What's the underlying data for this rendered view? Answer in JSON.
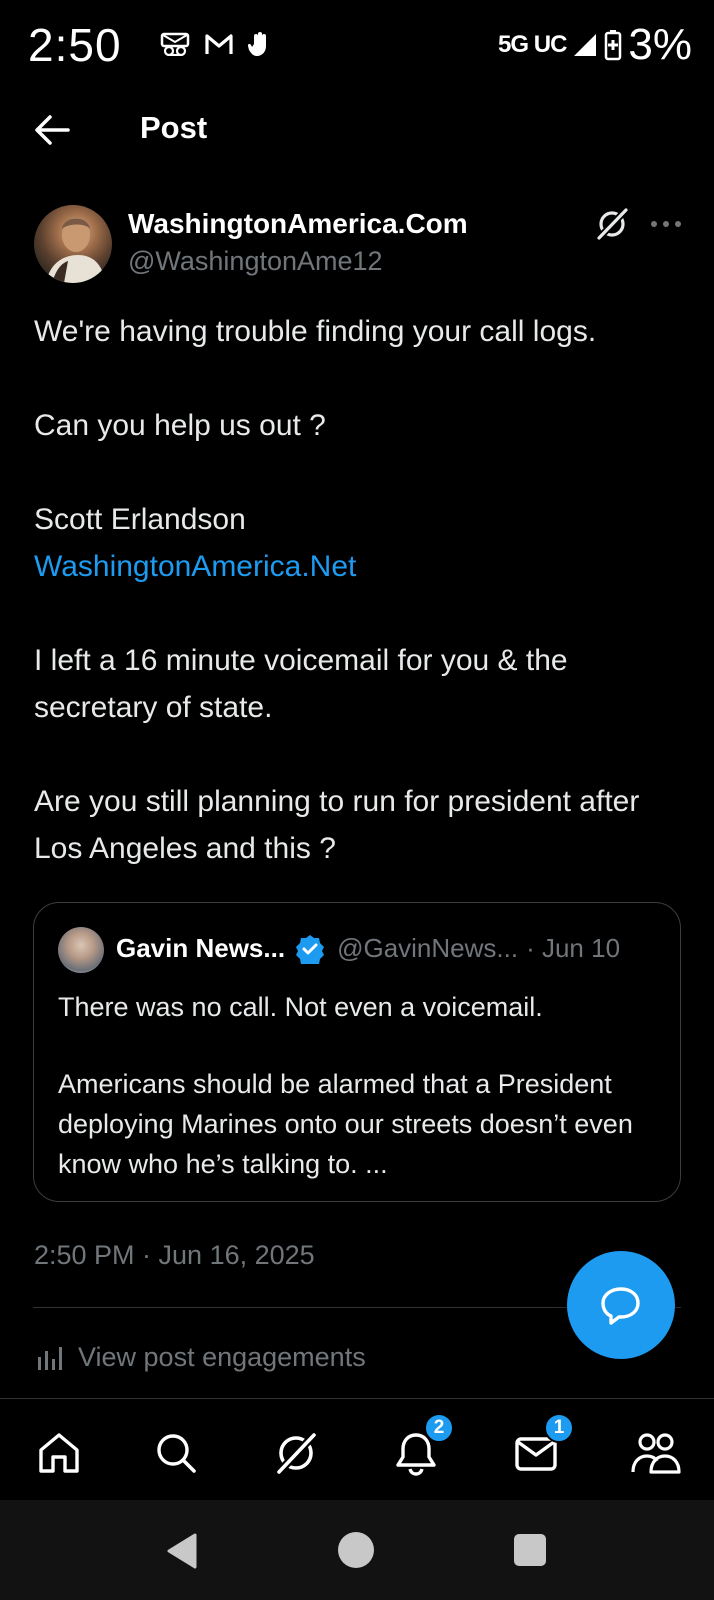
{
  "status_bar": {
    "time": "2:50",
    "icons": [
      "voicemail-icon",
      "gmail-icon",
      "hand-icon"
    ],
    "network": "5G UC",
    "battery": "3%"
  },
  "header": {
    "title": "Post"
  },
  "post": {
    "author_name": "WashingtonAmerica.Com",
    "author_handle": "@WashingtonAme12",
    "paragraphs": {
      "p1": "We're having trouble finding your call logs.",
      "p2": "Can you help us out ?",
      "p3_line1": "Scott Erlandson",
      "p3_link": "WashingtonAmerica.Net",
      "p4": "I left a 16 minute voicemail for you & the secretary of state.",
      "p5": "Are you still planning to run for president after Los Angeles and this ?"
    },
    "quote": {
      "name": "Gavin News...",
      "handle": "@GavinNews...",
      "date": "· Jun 10",
      "text1": "There was no call. Not even a voicemail.",
      "text2": "Americans should be alarmed that a President deploying Marines onto our streets doesn’t even know who he’s talking to. ..."
    },
    "timestamp": "2:50 PM · Jun 16, 2025",
    "engagements_label": "View post engagements"
  },
  "bottom_nav": {
    "notifications_badge": "2",
    "messages_badge": "1"
  },
  "colors": {
    "accent": "#1d9bf0",
    "background": "#000000",
    "muted_text": "#71767b"
  }
}
